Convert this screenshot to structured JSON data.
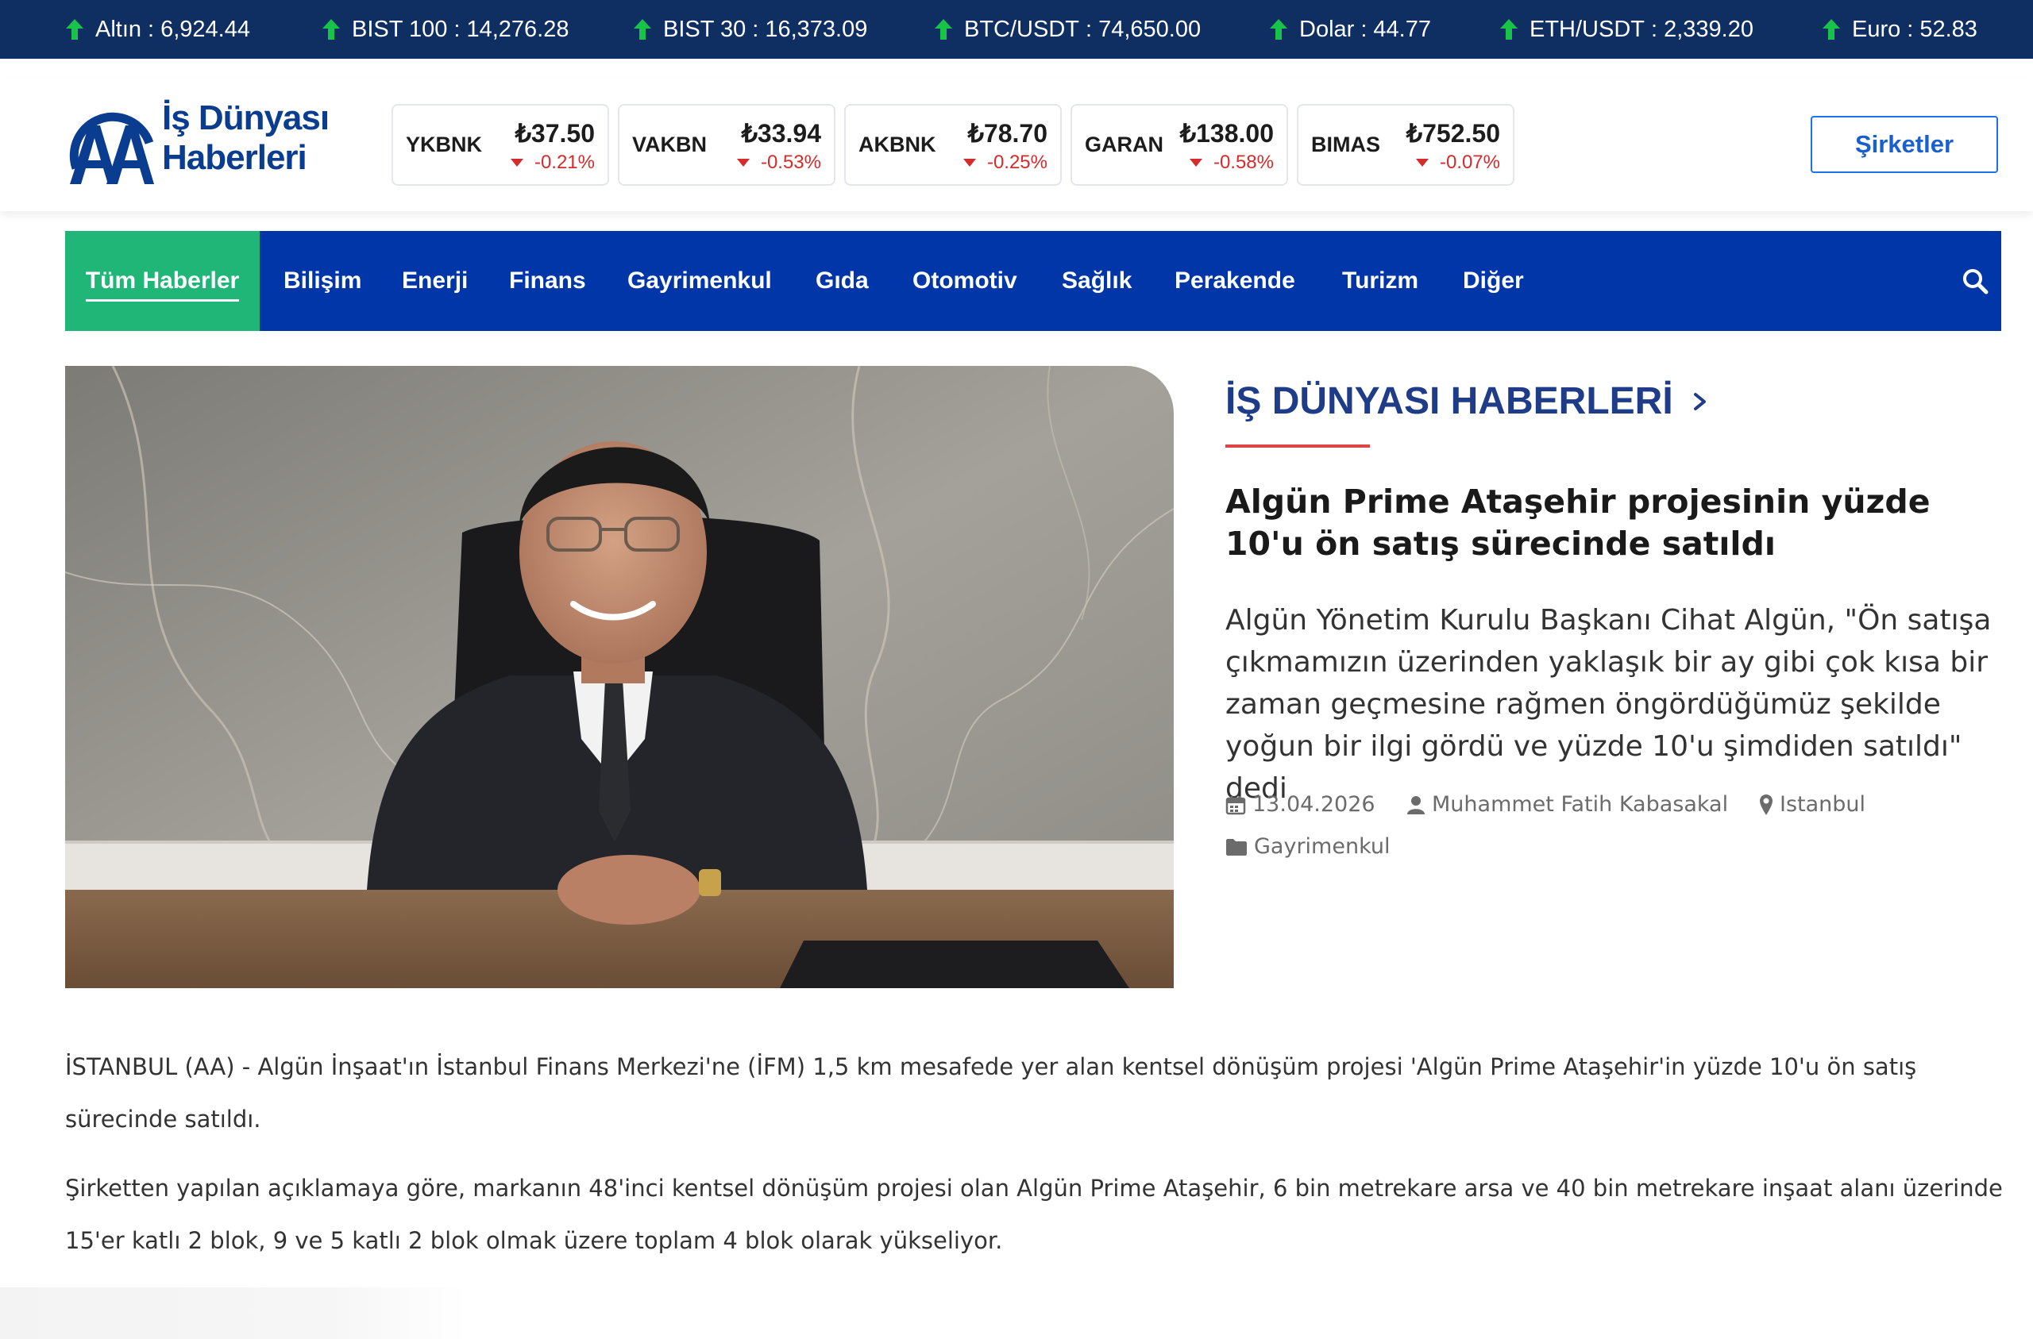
{
  "ticker": [
    {
      "name": "Altın",
      "value": "6,924.44",
      "trend": "up"
    },
    {
      "name": "BIST 100",
      "value": "14,276.28",
      "trend": "up"
    },
    {
      "name": "BIST 30",
      "value": "16,373.09",
      "trend": "up"
    },
    {
      "name": "BTC/USDT",
      "value": "74,650.00",
      "trend": "up"
    },
    {
      "name": "Dolar",
      "value": "44.77",
      "trend": "up"
    },
    {
      "name": "ETH/USDT",
      "value": "2,339.20",
      "trend": "up"
    },
    {
      "name": "Euro",
      "value": "52.83",
      "trend": "up"
    }
  ],
  "logo": {
    "line1": "İş Dünyası",
    "line2": "Haberleri",
    "mark": "AA"
  },
  "stocks": [
    {
      "symbol": "YKBNK",
      "price": "₺37.50",
      "change": "-0.21%",
      "trend": "down"
    },
    {
      "symbol": "VAKBN",
      "price": "₺33.94",
      "change": "-0.53%",
      "trend": "down"
    },
    {
      "symbol": "AKBNK",
      "price": "₺78.70",
      "change": "-0.25%",
      "trend": "down"
    },
    {
      "symbol": "GARAN",
      "price": "₺138.00",
      "change": "-0.58%",
      "trend": "down"
    },
    {
      "symbol": "BIMAS",
      "price": "₺752.50",
      "change": "-0.07%",
      "trend": "down"
    }
  ],
  "header": {
    "companies_button": "Şirketler"
  },
  "nav": {
    "items": [
      "Tüm Haberler",
      "Bilişim",
      "Enerji",
      "Finans",
      "Gayrimenkul",
      "Gıda",
      "Otomotiv",
      "Sağlık",
      "Perakende",
      "Turizm",
      "Diğer"
    ],
    "active_index": 0,
    "search_icon": "search-icon"
  },
  "article": {
    "section": "İŞ DÜNYASI HABERLERİ",
    "headline": "Algün Prime Ataşehir projesinin yüzde 10'u ön satış sürecinde satıldı",
    "summary": "Algün Yönetim Kurulu Başkanı Cihat Algün, \"Ön satışa çıkmamızın üzerinden yaklaşık bir ay gibi çok kısa bir zaman geçmesine rağmen öngördüğümüz şekilde yoğun bir ilgi gördü ve yüzde 10'u şimdiden satıldı\" dedi",
    "date": "13.04.2026",
    "author": "Muhammet Fatih Kabasakal",
    "location": "Istanbul",
    "category": "Gayrimenkul",
    "paragraphs": [
      "İSTANBUL (AA) - Algün İnşaat'ın İstanbul Finans Merkezi'ne (İFM) 1,5 km mesafede yer alan kentsel dönüşüm projesi 'Algün Prime Ataşehir'in yüzde 10'u ön satış sürecinde satıldı.",
      "Şirketten yapılan açıklamaya göre, markanın 48'inci kentsel dönüşüm projesi olan Algün Prime Ataşehir, 6 bin metrekare arsa ve 40 bin metrekare inşaat alanı üzerinde 15'er katlı 2 blok, 9 ve 5 katlı 2 blok olmak üzere toplam 4 blok olarak yükseliyor."
    ]
  },
  "colors": {
    "ticker_bg": "#0f2f63",
    "nav_bg": "#0136a8",
    "nav_active": "#1fb677",
    "brand_blue": "#1f3c88",
    "up_green": "#19c34a",
    "down_red": "#d62b2b",
    "accent_red": "#e04444"
  }
}
